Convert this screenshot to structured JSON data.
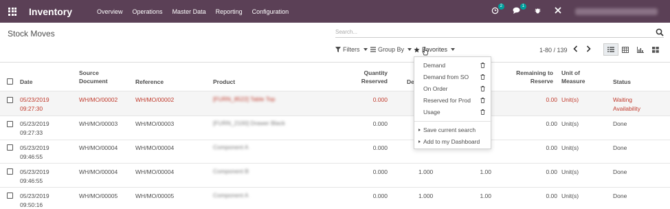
{
  "navbar": {
    "app_name": "Inventory",
    "menu": [
      "Overview",
      "Operations",
      "Master Data",
      "Reporting",
      "Configuration"
    ],
    "activity_badge": "2",
    "messages_badge": "1"
  },
  "control_panel": {
    "title": "Stock Moves",
    "search_placeholder": "Search...",
    "filters_label": "Filters",
    "group_by_label": "Group By",
    "favorites_label": "Favorites",
    "pager": "1-80 / 139"
  },
  "favorites_menu": {
    "items": [
      "Demand",
      "Demand from SO",
      "On Order",
      "Reserved for Prod",
      "Usage"
    ],
    "actions": [
      "Save current search",
      "Add to my Dashboard"
    ]
  },
  "table": {
    "headers": {
      "date": "Date",
      "source_line1": "Source",
      "source_line2": "Document",
      "reference": "Reference",
      "product": "Product",
      "qty_reserved_line1": "Quantity",
      "qty_reserved_line2": "Reserved",
      "demand_partial": "De",
      "remaining_line1": "Remaining to",
      "remaining_line2": "Reserve",
      "uom_line1": "Unit of",
      "uom_line2": "Measure",
      "status": "Status"
    },
    "rows": [
      {
        "date1": "05/23/2019",
        "date2": "09:27:30",
        "source": "WH/MO/00002",
        "reference": "WH/MO/00002",
        "product": "[FURN_8522] Table Top",
        "qty_reserved": "0.000",
        "demand": "",
        "qty_done": "",
        "remaining": "0.00",
        "uom": "Unit(s)",
        "status1": "Waiting",
        "status2": "Availability"
      },
      {
        "date1": "05/23/2019",
        "date2": "09:27:33",
        "source": "WH/MO/00003",
        "reference": "WH/MO/00003",
        "product": "[FURN_2100] Drawer Black",
        "qty_reserved": "0.000",
        "demand": "",
        "qty_done": "",
        "remaining": "0.00",
        "uom": "Unit(s)",
        "status1": "Done",
        "status2": ""
      },
      {
        "date1": "05/23/2019",
        "date2": "09:46:55",
        "source": "WH/MO/00004",
        "reference": "WH/MO/00004",
        "product": "Component A",
        "qty_reserved": "0.000",
        "demand": "",
        "qty_done": "",
        "remaining": "0.00",
        "uom": "Unit(s)",
        "status1": "Done",
        "status2": ""
      },
      {
        "date1": "05/23/2019",
        "date2": "09:46:55",
        "source": "WH/MO/00004",
        "reference": "WH/MO/00004",
        "product": "Component B",
        "qty_reserved": "0.000",
        "demand": "1.000",
        "qty_done": "1.00",
        "remaining": "0.00",
        "uom": "Unit(s)",
        "status1": "Done",
        "status2": ""
      },
      {
        "date1": "05/23/2019",
        "date2": "09:50:16",
        "source": "WH/MO/00005",
        "reference": "WH/MO/00005",
        "product": "Component A",
        "qty_reserved": "0.000",
        "demand": "1.000",
        "qty_done": "1.00",
        "remaining": "0.00",
        "uom": "Unit(s)",
        "status1": "Done",
        "status2": ""
      }
    ]
  },
  "colors": {
    "navbar": "#5b4056",
    "waiting_row_text": "#c0392b",
    "badge": "#00a09d"
  }
}
